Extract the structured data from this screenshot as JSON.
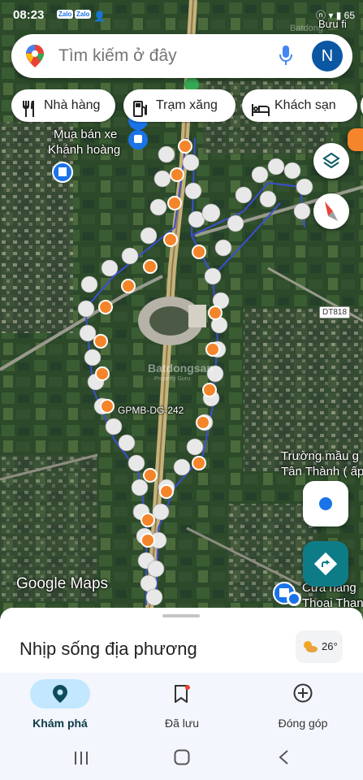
{
  "status_bar": {
    "time": "08:23",
    "notifications": [
      "Zalo",
      "Zalo"
    ],
    "system": "ⓝ ▾ ▮ 65"
  },
  "search": {
    "placeholder": "Tìm kiếm ở đây",
    "avatar_initial": "N"
  },
  "chips": [
    {
      "label": "Nhà hàng",
      "icon": "restaurant-icon"
    },
    {
      "label": "Trạm xăng",
      "icon": "gas-station-icon"
    },
    {
      "label": "Khách sạn",
      "icon": "hotel-icon"
    }
  ],
  "map": {
    "labels": {
      "top_right": "Bưu fi",
      "shop_line1": "Mua bán xe",
      "shop_line2": "Khánh hoàng",
      "parcel_code": "GPMB-DG-242",
      "school_line1": "Trường mầu g",
      "school_line2": "Tân Thành ( ấp",
      "store_line1": "Cửa hàng",
      "store_line2": "Thoại Than",
      "road_shield": "DT818",
      "watermark_center": "Batdongsan",
      "watermark_sub": "Property Guru",
      "watermark_top": "Batdong"
    },
    "attribution": "Google Maps"
  },
  "bottom_sheet": {
    "title": "Nhịp sống địa phương",
    "weather_temp": "26°"
  },
  "nav": [
    {
      "label": "Khám phá",
      "icon": "explore-pin-icon",
      "active": true
    },
    {
      "label": "Đã lưu",
      "icon": "saved-bookmark-icon",
      "active": false
    },
    {
      "label": "Đóng góp",
      "icon": "contribute-plus-icon",
      "active": false
    }
  ],
  "colors": {
    "accent_blue": "#1a73e8",
    "active_pill": "#c2e7ff",
    "route_orange": "#f5852a",
    "route_blue": "#3b4fd1",
    "directions_teal": "#0e7c86"
  }
}
